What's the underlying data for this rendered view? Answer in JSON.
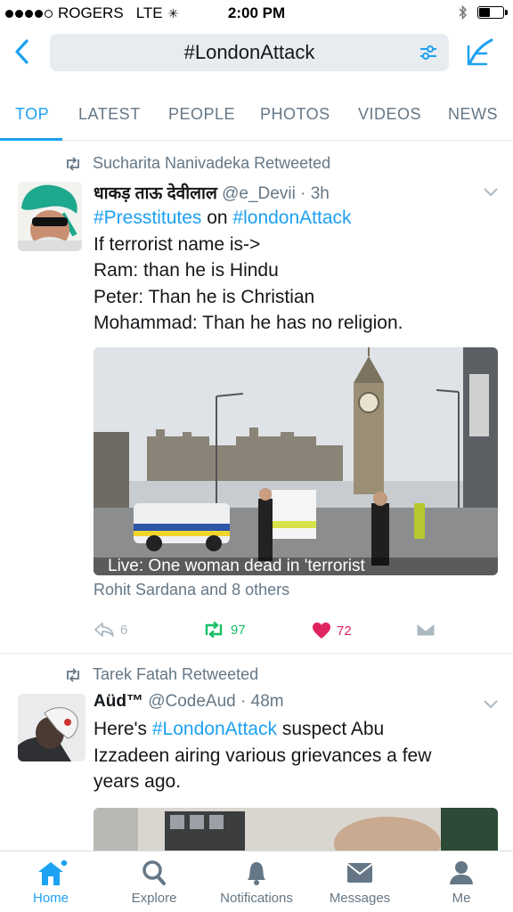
{
  "status_bar": {
    "carrier": "ROGERS",
    "network": "LTE",
    "time": "2:00 PM"
  },
  "header": {
    "search_query": "#LondonAttack"
  },
  "tabs": [
    {
      "label": "TOP",
      "active": true
    },
    {
      "label": "LATEST",
      "active": false
    },
    {
      "label": "PEOPLE",
      "active": false
    },
    {
      "label": "PHOTOS",
      "active": false
    },
    {
      "label": "VIDEOS",
      "active": false
    },
    {
      "label": "NEWS",
      "active": false
    }
  ],
  "tweets": [
    {
      "retweeted_by": "Sucharita Nanivadeka Retweeted",
      "display_name": "धाकड़ ताऊ देवीलाल",
      "handle": "@e_Devii",
      "time": "3h",
      "text_line1_tag1": "#Presstitutes",
      "text_line1_mid": " on ",
      "text_line1_tag2": "#londonAttack",
      "text_lines": [
        "If terrorist name is->",
        "Ram: than he is Hindu",
        "Peter: Than he is Christian",
        "Mohammad: Than he has no religion."
      ],
      "media_caption": "Live: One woman dead in 'terrorist",
      "others": "Rohit Sardana and 8 others",
      "reply_count": "6",
      "retweet_count": "97",
      "like_count": "72"
    },
    {
      "retweeted_by": "Tarek Fatah Retweeted",
      "display_name": "Aüd™",
      "handle": "@CodeAud",
      "time": "48m",
      "text_line1_pre": "Here's ",
      "text_line1_tag": "#LondonAttack",
      "text_line1_post": " suspect Abu",
      "text_lines": [
        "Izzadeen airing various grievances a few",
        "years ago."
      ]
    }
  ],
  "bottom_nav": [
    {
      "label": "Home",
      "icon": "home-icon",
      "active": true
    },
    {
      "label": "Explore",
      "icon": "search-icon",
      "active": false
    },
    {
      "label": "Notifications",
      "icon": "bell-icon",
      "active": false
    },
    {
      "label": "Messages",
      "icon": "envelope-icon",
      "active": false
    },
    {
      "label": "Me",
      "icon": "person-icon",
      "active": false
    }
  ],
  "colors": {
    "accent": "#1da1f2",
    "retweet_green": "#17bf63",
    "like_red": "#e0245e",
    "muted": "#657786"
  }
}
